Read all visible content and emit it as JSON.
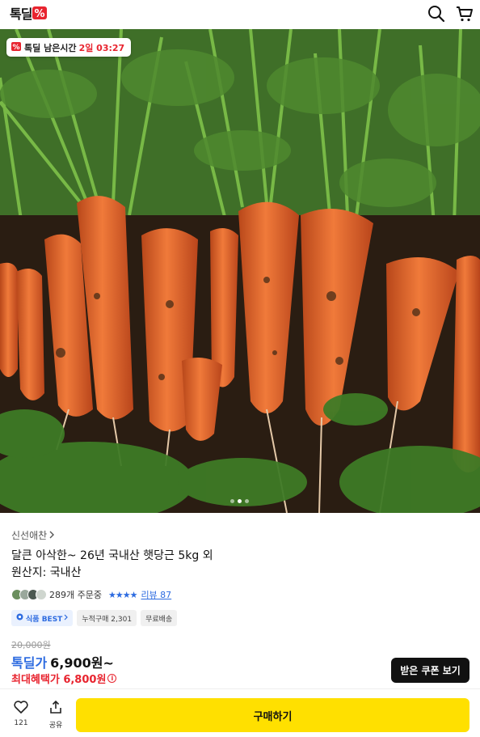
{
  "header": {
    "logo_text": "톡딜",
    "icons": [
      "search-icon",
      "cart-icon"
    ]
  },
  "hero": {
    "badge_label": "톡딜 남은시간",
    "badge_time": "2일 03:27",
    "carousel_total": 3,
    "carousel_active": 1
  },
  "product": {
    "seller": "신선애찬",
    "title": "달큰 아삭한~ 26년 국내산 햇당근 5kg 외",
    "origin": "원산지: 국내산",
    "orders": "289개 주문중",
    "stars": "★★★★",
    "review": "리뷰 87",
    "tags": [
      "식품 BEST",
      "누적구매 2,301",
      "무료배송"
    ],
    "original_price": "20,000원",
    "deal_label": "톡딜가",
    "deal_price": "6,900원~",
    "max_benefit": "최대혜택가 6,800원"
  },
  "actions": {
    "coupon": "받은 쿠폰 보기",
    "like_count": "121",
    "share": "공유",
    "buy": "구매하기"
  },
  "colors": {
    "accent_blue": "#2d6be0",
    "accent_red": "#e8242f",
    "buy_yellow": "#ffe000"
  }
}
